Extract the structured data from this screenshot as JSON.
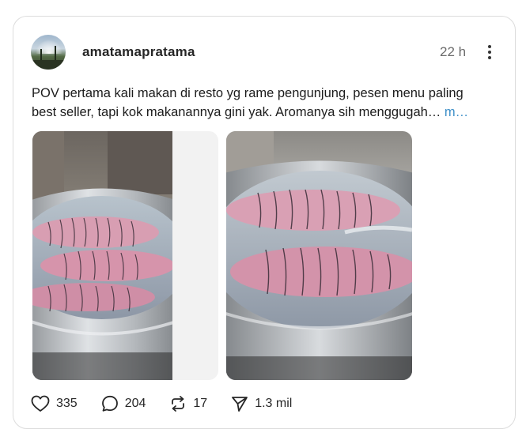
{
  "post": {
    "username": "amatamapratama",
    "time": "22 h",
    "caption_line1": "POV pertama kali makan di resto yg rame pengunjung, pesen menu paling",
    "caption_line2": "best seller, tapi kok makanannya gini yak. Aromanya sih menggugah…",
    "more_label": "m…"
  },
  "actions": {
    "likes": "335",
    "comments": "204",
    "reposts": "17",
    "shares": "1.3 mil"
  },
  "icons": {
    "like": "heart-icon",
    "comment": "speech-bubble-icon",
    "repost": "repost-arrows-icon",
    "share": "paper-plane-icon",
    "menu": "more-vertical-icon"
  },
  "colors": {
    "link": "#3d8fc8",
    "text": "#1c1c1c",
    "muted": "#6b6b6b",
    "border": "#dcdcdc"
  }
}
